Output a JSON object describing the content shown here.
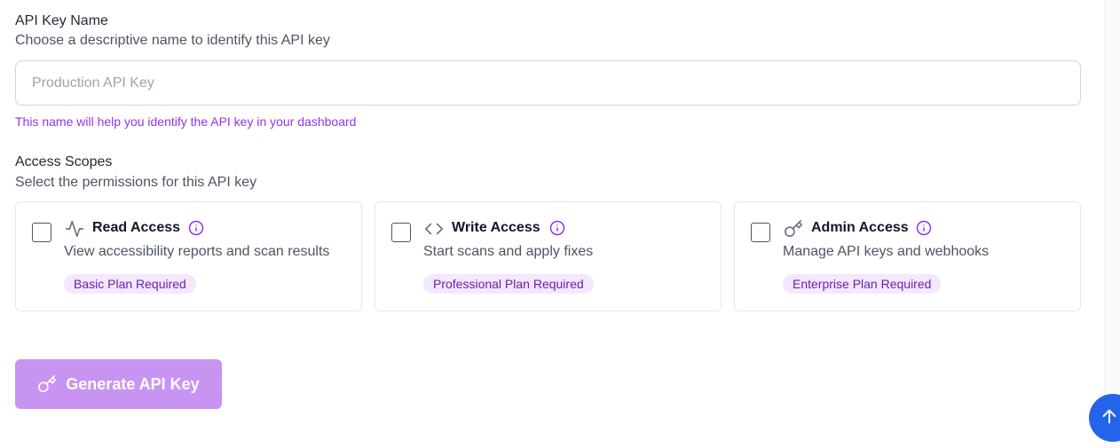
{
  "name_field": {
    "label": "API Key Name",
    "description": "Choose a descriptive name to identify this API key",
    "placeholder": "Production API Key",
    "value": "",
    "helper": "This name will help you identify the API key in your dashboard"
  },
  "scopes": {
    "label": "Access Scopes",
    "description": "Select the permissions for this API key",
    "items": [
      {
        "title": "Read Access",
        "description": "View accessibility reports and scan results",
        "badge": "Basic Plan Required",
        "icon": "activity-icon",
        "checked": false
      },
      {
        "title": "Write Access",
        "description": "Start scans and apply fixes",
        "badge": "Professional Plan Required",
        "icon": "code-icon",
        "checked": false
      },
      {
        "title": "Admin Access",
        "description": "Manage API keys and webhooks",
        "badge": "Enterprise Plan Required",
        "icon": "key-icon",
        "checked": false
      }
    ]
  },
  "generate_button": {
    "label": "Generate API Key",
    "icon": "key-icon",
    "disabled": true
  },
  "scroll_top": {
    "icon": "arrow-up-icon"
  },
  "colors": {
    "accent": "#9333ea",
    "button_disabled": "#c894f2",
    "badge_bg": "#f3e8ff",
    "badge_text": "#6b21a8",
    "scroll_button": "#2563eb"
  }
}
